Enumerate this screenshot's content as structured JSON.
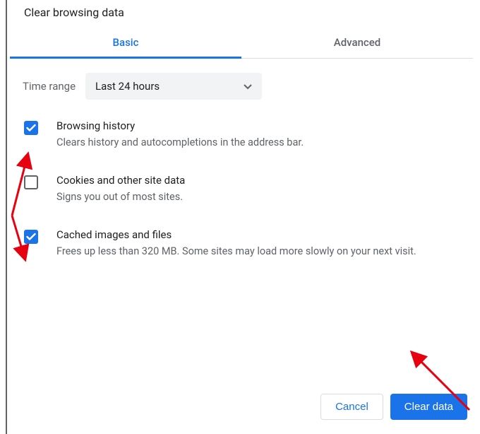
{
  "dialog": {
    "title": "Clear browsing data"
  },
  "tabs": {
    "basic": "Basic",
    "advanced": "Advanced",
    "active": "basic"
  },
  "time_range": {
    "label": "Time range",
    "selected": "Last 24 hours"
  },
  "items": [
    {
      "checked": true,
      "title": "Browsing history",
      "desc": "Clears history and autocompletions in the address bar."
    },
    {
      "checked": false,
      "title": "Cookies and other site data",
      "desc": "Signs you out of most sites."
    },
    {
      "checked": true,
      "title": "Cached images and files",
      "desc": "Frees up less than 320 MB. Some sites may load more slowly on your next visit."
    }
  ],
  "footer": {
    "cancel": "Cancel",
    "clear": "Clear data"
  },
  "colors": {
    "accent": "#1a73e8",
    "text_secondary": "#5f6368",
    "annotation": "#e7000f"
  }
}
